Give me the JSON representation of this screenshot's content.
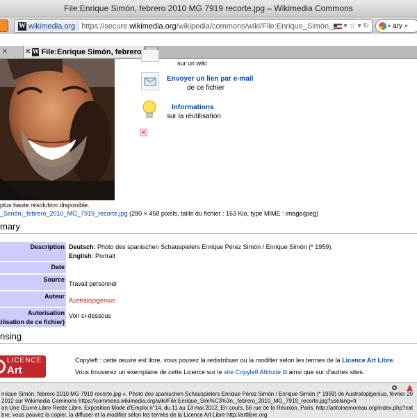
{
  "window": {
    "title": "File:Enrique Simón, febrero 2010 MG 7919 recorte.jpg – Wikimedia Commons"
  },
  "toolbar": {
    "site_chip": "wikimedia.org",
    "url_prefix": "https://secure.",
    "url_domain": "wikimedia.org",
    "url_rest": "/wikipedia/commons/wiki/File:Enrique_Simón,_febrero_2010_MG",
    "search_value": "ary"
  },
  "tabs": [
    {
      "label": ""
    },
    {
      "label": "File:Enrique Simón, febrero 2010"
    }
  ],
  "actions": {
    "top_partial": "sur un wiki",
    "email_title": "Envoyer un lien par e-mail",
    "email_sub": "de ce fichier",
    "info_title": "Informations",
    "info_sub": "sur la réutilisation"
  },
  "file": {
    "lowres_note": "plus haute résolution disponible.",
    "file_link": "_Simón,_febrero_2010_MG_7919_recorte.jpg",
    "file_meta": " (280 × 458 pixels, taille du fichier : 163 Kio, type MIME : image/jpeg)"
  },
  "summary": {
    "heading": "mary",
    "rows": {
      "description_label": "Description",
      "desc_de_lang": "Deutsch:",
      "desc_de_text": " Photo des spanischen Schauspielers Enrique Pérez Simón / Enrique Simón (* 1959).",
      "desc_en_lang": "English:",
      "desc_en_text": " Portrait",
      "date_label": "Date",
      "date_value": "",
      "source_label": "Source",
      "source_value": "Travail personnel",
      "author_label": "Auteur",
      "author_value": "Australopigenius",
      "perm_label": "Autorisation",
      "perm_label2": "tilisation de ce fichier)",
      "perm_value": "Voir ci-dessous"
    }
  },
  "licensing": {
    "heading": "nsing",
    "logo_line1": "LICENCE",
    "logo_line2": "Art libre",
    "line1_pre": "Copyleft : cette œuvre est libre, vous pouvez la redistribuer ou la modifier selon les termes de la ",
    "line1_link": "Licence Art Libre",
    "line1_post": ".",
    "line2_pre": "Vous trouverez un exemplaire de cette Licence sur le ",
    "line2_link": "site Copyleft Attitude",
    "line2_post": " ainsi que sur d'autres sites."
  },
  "statusbar": {
    "line1": "nrique Simón, febrero 2010 MG 7919 recorte.jpg », Photo des spanischen Schauspielers Enrique Pérez Simón / Enrique Simón (* 1959) de Australopigenius, février 20",
    "line2": " 2012 sur Wikimedia Commons https://commons.wikimedia.org/wiki/File:Enrique_Sim%C3%3n,_febrero_2010_MG_7919_recorte.jpg?uselang=fr",
    "line3": "an Une Œuvre Libre Reste Libre. Exposition Mode d'Emploi n°14, du 11 au 13 mai 2012, En cours, 56 rue de la Réunion, Paris. http://antoinemoreau.org/index.php?cat",
    "line4": "bre, vous pouvez la copier, la diffuser et la modifier selon les termes de la Licence Art Libre http://artlibre.org"
  }
}
